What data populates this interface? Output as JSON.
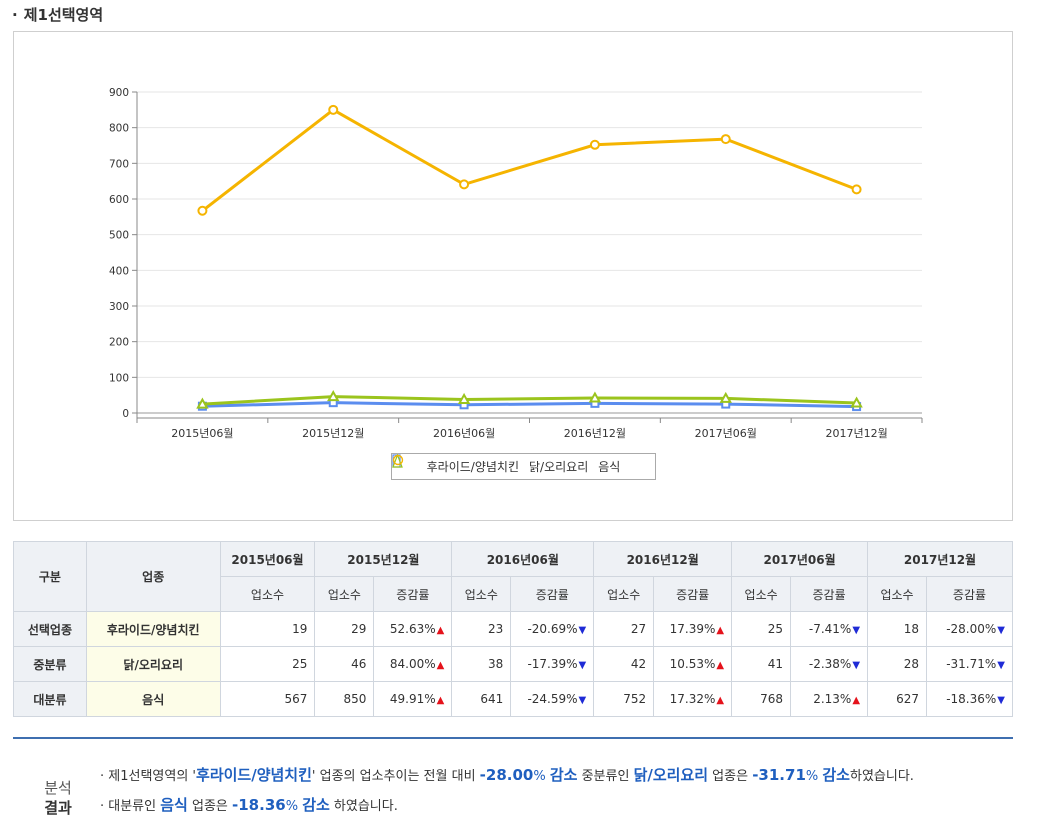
{
  "section": {
    "bullet": "·",
    "title": "제1선택영역"
  },
  "colors": {
    "series1": "#5b8def",
    "series2": "#9bc41d",
    "series3": "#f5b400",
    "up": "#e5121b",
    "down": "#1f2bd6",
    "accent": "#1f5fbf"
  },
  "chart_data": {
    "type": "line",
    "title": "",
    "xlabel": "",
    "ylabel": "",
    "ylim": [
      0,
      900
    ],
    "yticks": [
      0,
      100,
      200,
      300,
      400,
      500,
      600,
      700,
      800,
      900
    ],
    "categories": [
      "2015년06월",
      "2015년12월",
      "2016년06월",
      "2016년12월",
      "2017년06월",
      "2017년12월"
    ],
    "series": [
      {
        "name": "후라이드/양념치킨",
        "marker": "square",
        "values": [
          19,
          29,
          23,
          27,
          25,
          18
        ]
      },
      {
        "name": "닭/오리요리",
        "marker": "triangle",
        "values": [
          25,
          46,
          38,
          42,
          41,
          28
        ]
      },
      {
        "name": "음식",
        "marker": "circle",
        "values": [
          567,
          850,
          641,
          752,
          768,
          627
        ]
      }
    ],
    "grid": true,
    "legend": "bottom"
  },
  "table": {
    "h_category": "구분",
    "h_industry": "업종",
    "periods": [
      "2015년06월",
      "2015년12월",
      "2016년06월",
      "2016년12월",
      "2017년06월",
      "2017년12월"
    ],
    "sub_count": "업소수",
    "sub_rate": "증감률",
    "rows": [
      {
        "label": "선택업종",
        "industry": "후라이드/양념치킨",
        "counts": [
          "19",
          "29",
          "23",
          "27",
          "25",
          "18"
        ],
        "rates": [
          "52.63%",
          "-20.69%",
          "17.39%",
          "-7.41%",
          "-28.00%"
        ],
        "dirs": [
          "up",
          "down",
          "up",
          "down",
          "down"
        ]
      },
      {
        "label": "중분류",
        "industry": "닭/오리요리",
        "counts": [
          "25",
          "46",
          "38",
          "42",
          "41",
          "28"
        ],
        "rates": [
          "84.00%",
          "-17.39%",
          "10.53%",
          "-2.38%",
          "-31.71%"
        ],
        "dirs": [
          "up",
          "down",
          "up",
          "down",
          "down"
        ]
      },
      {
        "label": "대분류",
        "industry": "음식",
        "counts": [
          "567",
          "850",
          "641",
          "752",
          "768",
          "627"
        ],
        "rates": [
          "49.91%",
          "-24.59%",
          "17.32%",
          "2.13%",
          "-18.36%"
        ],
        "dirs": [
          "up",
          "down",
          "up",
          "up",
          "down"
        ]
      }
    ]
  },
  "result": {
    "label1": "분석",
    "label2": "결과",
    "p1": {
      "t1": "제1선택영역의 '",
      "hl1": "후라이드/양념치킨",
      "t2": "' 업종의 업소추이는 전월 대비 ",
      "v1": "-28.00",
      "t3": "% ",
      "d1": "감소",
      "t4": " 중분류인 ",
      "hl2": "닭/오리요리",
      "t5": " 업종은 ",
      "v2": "-31.71",
      "t6": "% ",
      "d2": "감소",
      "t7": "하였습니다."
    },
    "p2": {
      "t1": "대분류인 ",
      "hl1": "음식",
      "t2": " 업종은 ",
      "v1": "-18.36",
      "t3": "% ",
      "d1": "감소",
      "t4": " 하였습니다."
    }
  }
}
